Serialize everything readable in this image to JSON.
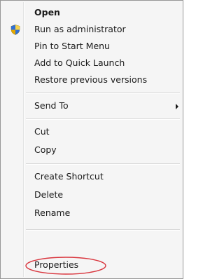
{
  "menu": {
    "items": [
      {
        "label": "Open"
      },
      {
        "label": "Run as administrator"
      },
      {
        "label": "Pin to Start Menu"
      },
      {
        "label": "Add to Quick Launch"
      },
      {
        "label": "Restore previous versions"
      },
      {
        "label": "Send To"
      },
      {
        "label": "Cut"
      },
      {
        "label": "Copy"
      },
      {
        "label": "Create Shortcut"
      },
      {
        "label": "Delete"
      },
      {
        "label": "Rename"
      },
      {
        "label": "Properties"
      }
    ]
  },
  "icons": {
    "run_as_admin": "uac-shield-icon",
    "send_to": "submenu-arrow-icon"
  },
  "colors": {
    "highlight_ellipse": "#d9363e"
  }
}
